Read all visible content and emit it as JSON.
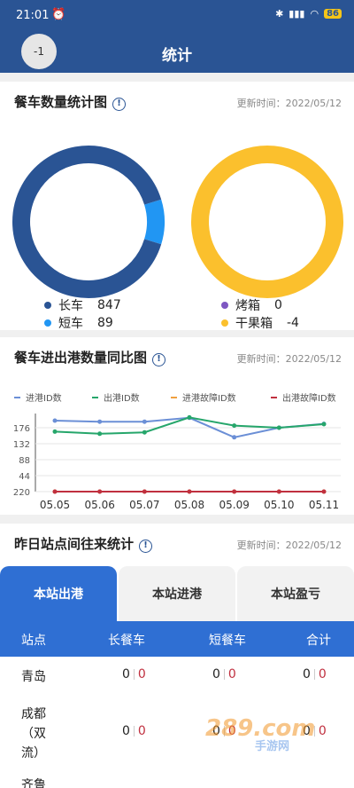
{
  "status": {
    "time": "21:01",
    "battery": "86"
  },
  "header": {
    "back_label": "-1",
    "title": "统计"
  },
  "card1": {
    "title": "餐车数量统计图",
    "updated": "更新时间：2022/05/12",
    "legend_left": [
      {
        "label": "长车",
        "value": "847",
        "color": "#2a5494"
      },
      {
        "label": "短车",
        "value": "89",
        "color": "#2196f3"
      }
    ],
    "legend_right": [
      {
        "label": "烤箱",
        "value": "0",
        "color": "#7e57c2"
      },
      {
        "label": "干果箱",
        "value": "-4",
        "color": "#fbc02d"
      }
    ]
  },
  "card2": {
    "title": "餐车进出港数量同比图",
    "updated": "更新时间：2022/05/12",
    "legend": [
      {
        "label": "进港ID数",
        "color": "#6b8fd6"
      },
      {
        "label": "出港ID数",
        "color": "#26a66b"
      },
      {
        "label": "进港故障ID数",
        "color": "#f0a040"
      },
      {
        "label": "出港故障ID数",
        "color": "#c0303f"
      }
    ]
  },
  "chart_data": [
    {
      "type": "pie",
      "categories": [
        "长车",
        "短车"
      ],
      "values": [
        847,
        89
      ],
      "colors": [
        "#2a5494",
        "#2196f3"
      ],
      "donut": true
    },
    {
      "type": "pie",
      "categories": [
        "烤箱",
        "干果箱"
      ],
      "values": [
        0,
        4
      ],
      "colors": [
        "#7e57c2",
        "#fbc02d"
      ],
      "donut": true
    },
    {
      "type": "line",
      "x": [
        "05.05",
        "05.06",
        "05.07",
        "05.08",
        "05.09",
        "05.10",
        "05.11"
      ],
      "y_ticks": [
        "176",
        "132",
        "88",
        "44",
        "220"
      ],
      "ylim": [
        0,
        220
      ],
      "grid": true,
      "series": [
        {
          "name": "进港ID数",
          "color": "#6b8fd6",
          "values": [
            200,
            197,
            197,
            208,
            153,
            180,
            191
          ]
        },
        {
          "name": "出港ID数",
          "color": "#26a66b",
          "values": [
            169,
            163,
            167,
            209,
            186,
            180,
            190
          ]
        },
        {
          "name": "进港故障ID数",
          "color": "#f0a040",
          "values": [
            0,
            0,
            0,
            0,
            0,
            0,
            0
          ]
        },
        {
          "name": "出港故障ID数",
          "color": "#c0303f",
          "values": [
            0,
            0,
            0,
            0,
            0,
            0,
            0
          ]
        }
      ]
    }
  ],
  "card3": {
    "title": "昨日站点间往来统计",
    "updated": "更新时间：2022/05/12"
  },
  "tabs": [
    "本站出港",
    "本站进港",
    "本站盈亏"
  ],
  "table": {
    "headers": [
      "站点",
      "长餐车",
      "短餐车",
      "合计"
    ],
    "rows": [
      {
        "name": "青岛",
        "long": [
          "0",
          "0"
        ],
        "short": [
          "0",
          "0"
        ],
        "total": [
          "0",
          "0"
        ]
      },
      {
        "name": "成都\n（双\n流）",
        "long": [
          "0",
          "0"
        ],
        "short": [
          "0",
          "0"
        ],
        "total": [
          "0",
          "0"
        ]
      },
      {
        "name": "齐鲁",
        "long": [
          "",
          ""
        ],
        "short": [
          "",
          ""
        ],
        "total": [
          "",
          ""
        ]
      }
    ]
  },
  "watermark": {
    "main": "289.com",
    "sub": "手游网"
  }
}
